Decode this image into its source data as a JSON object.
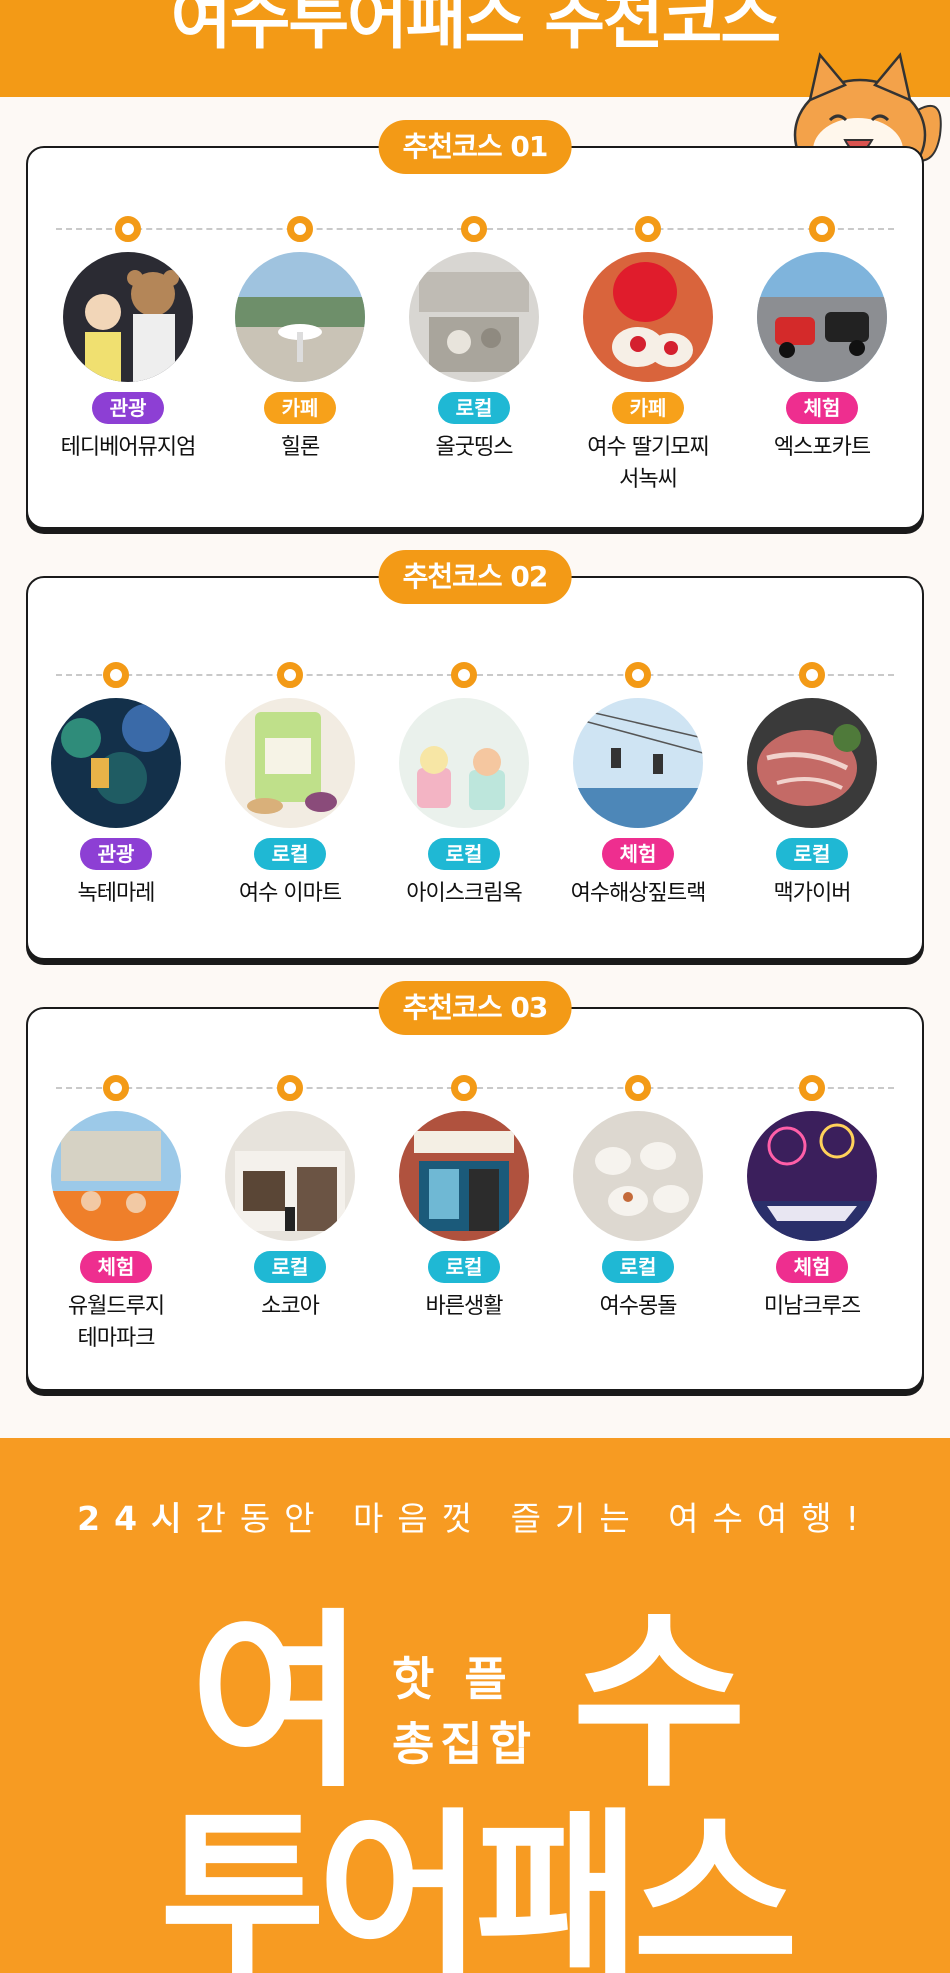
{
  "header": {
    "title": "여수투어패스 추천코스"
  },
  "colors": {
    "accent": "#f39a16",
    "tour": "#8d3fd4",
    "cafe": "#f7a11a",
    "local": "#1fb8d4",
    "exp": "#ee2e8f"
  },
  "courses": [
    {
      "title": "추천코스 01",
      "stops": [
        {
          "badge": "관광",
          "name": "테디베어뮤지엄",
          "photo": "teddy-bear-museum-photo"
        },
        {
          "badge": "카페",
          "name": "힐론",
          "photo": "cafe-hillon-photo"
        },
        {
          "badge": "로컬",
          "name": "올굿띵스",
          "photo": "shop-photo"
        },
        {
          "badge": "카페",
          "name": "여수 딸기모찌\n서녹씨",
          "photo": "strawberry-mochi-photo"
        },
        {
          "badge": "체험",
          "name": "엑스포카트",
          "photo": "go-kart-photo"
        }
      ]
    },
    {
      "title": "추천코스 02",
      "stops": [
        {
          "badge": "관광",
          "name": "녹테마레",
          "photo": "light-show-photo"
        },
        {
          "badge": "로컬",
          "name": "여수 이마트",
          "photo": "snack-package-photo"
        },
        {
          "badge": "로컬",
          "name": "아이스크림옥",
          "photo": "ice-cream-photo"
        },
        {
          "badge": "체험",
          "name": "여수해상짚트랙",
          "photo": "zipline-photo"
        },
        {
          "badge": "로컬",
          "name": "맥가이버",
          "photo": "meat-photo"
        }
      ]
    },
    {
      "title": "추천코스 03",
      "stops": [
        {
          "badge": "체험",
          "name": "유월드루지\n테마파크",
          "photo": "luge-photo"
        },
        {
          "badge": "로컬",
          "name": "소코아",
          "photo": "storefront-photo"
        },
        {
          "badge": "로컬",
          "name": "바른생활",
          "photo": "shop-front-photo"
        },
        {
          "badge": "로컬",
          "name": "여수몽돌",
          "photo": "dessert-photo"
        },
        {
          "badge": "체험",
          "name": "미남크루즈",
          "photo": "fireworks-cruise-photo"
        }
      ]
    }
  ],
  "banner": {
    "tagline_bold": "24시",
    "tagline_rest": "간동안 마음껏 즐기는 여수여행!",
    "big_left": "여",
    "big_right": "수",
    "mid_line1": "핫플",
    "mid_line2": "총집합",
    "big_bottom": "투어패스"
  }
}
